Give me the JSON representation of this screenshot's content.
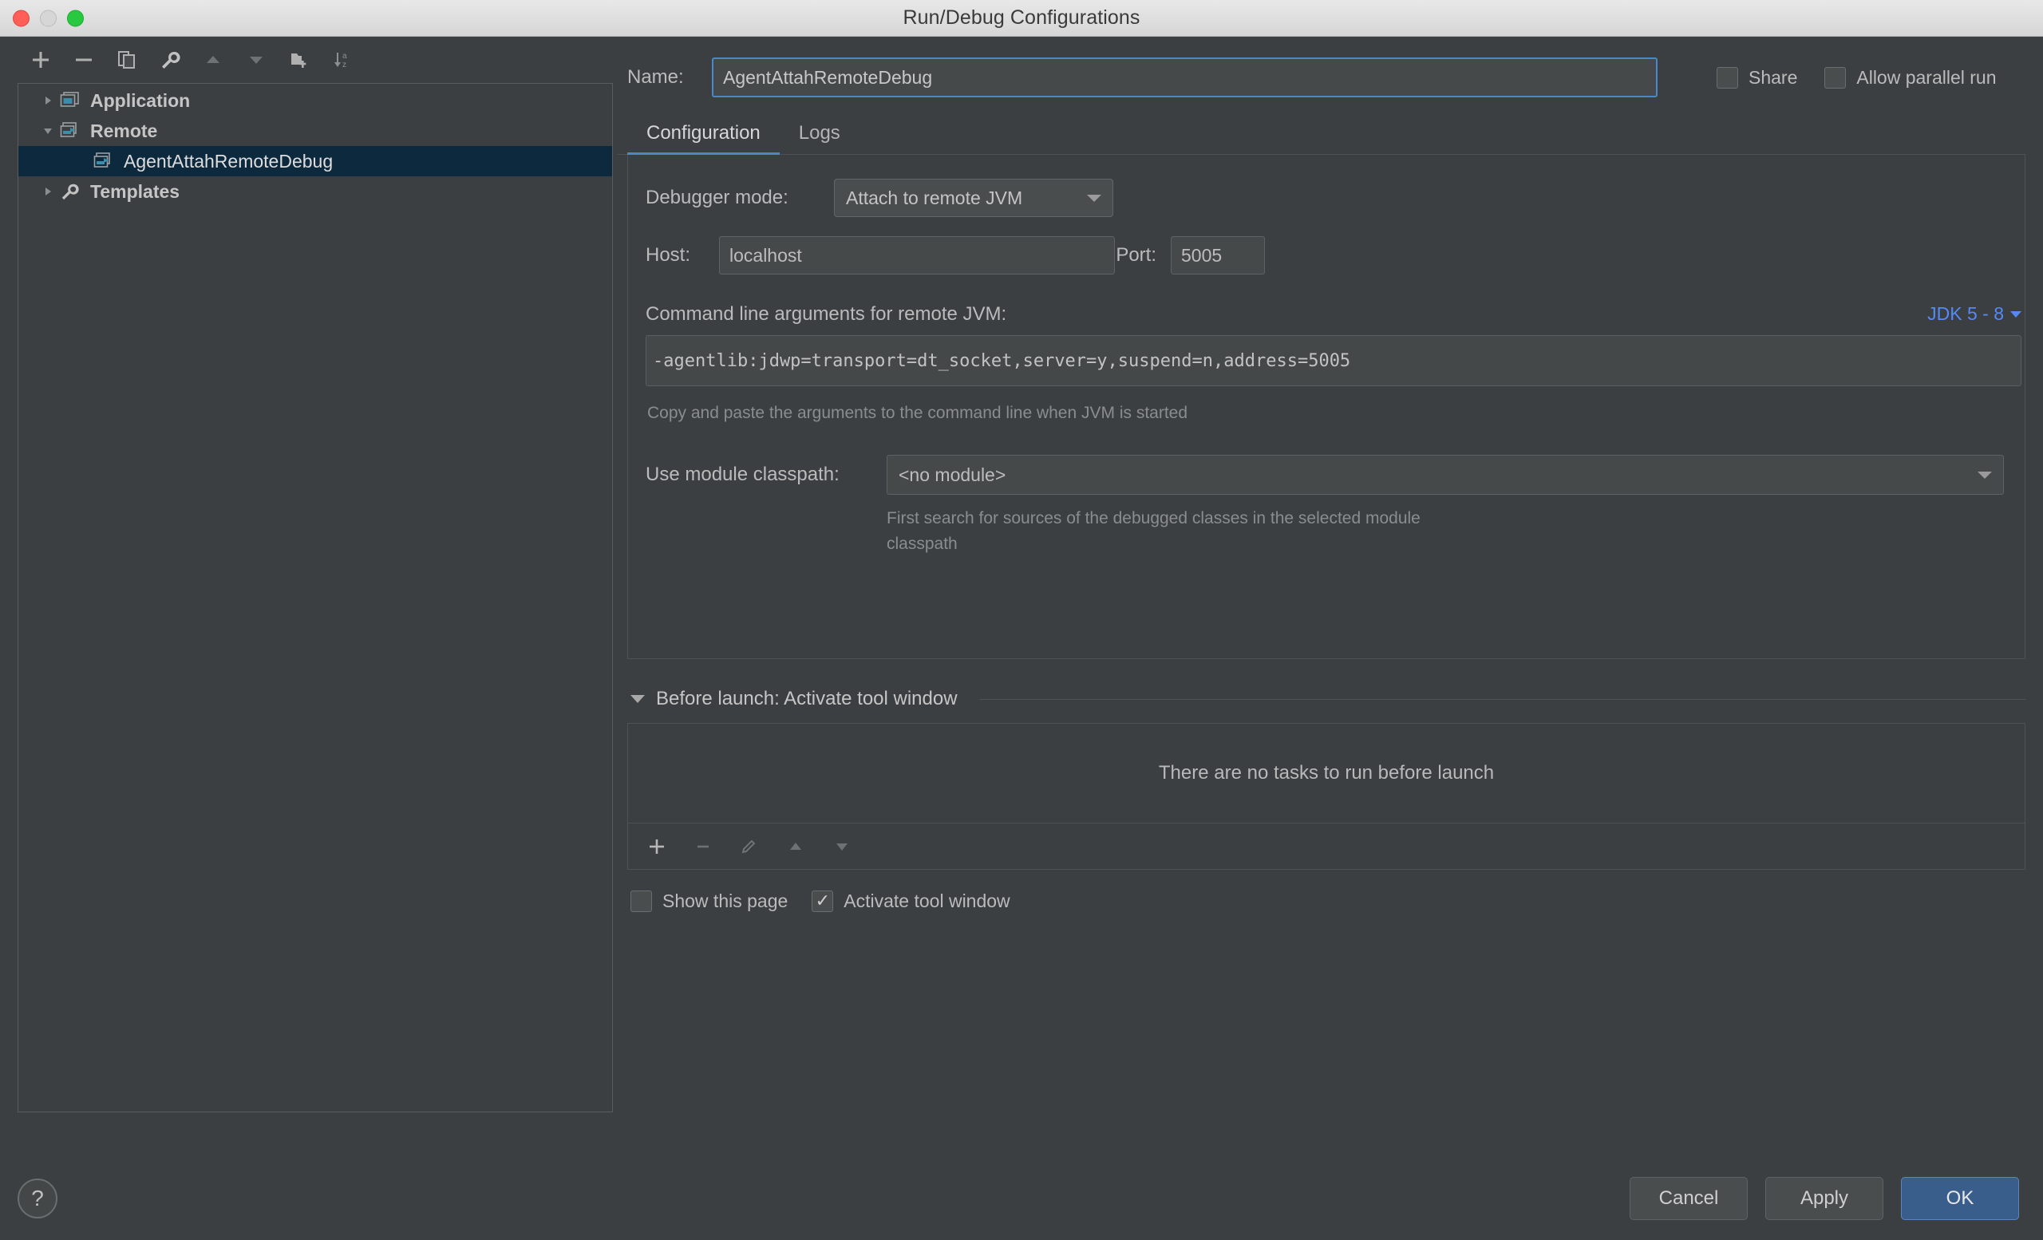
{
  "window": {
    "title": "Run/Debug Configurations",
    "traffic_lights": [
      "close",
      "minimize",
      "maximize"
    ]
  },
  "tree_toolbar": {
    "buttons": [
      {
        "name": "add",
        "icon": "plus-icon"
      },
      {
        "name": "remove",
        "icon": "minus-icon"
      },
      {
        "name": "copy",
        "icon": "copy-icon"
      },
      {
        "name": "edit-templates",
        "icon": "wrench-icon"
      },
      {
        "name": "move-up",
        "icon": "arrow-up-icon"
      },
      {
        "name": "move-down",
        "icon": "arrow-down-icon"
      },
      {
        "name": "move-into-folder",
        "icon": "folder-add-icon"
      },
      {
        "name": "sort-alphabetically",
        "icon": "sort-az-icon"
      }
    ]
  },
  "tree": {
    "items": [
      {
        "label": "Application",
        "expanded": false,
        "selected": false,
        "icon": "application-icon",
        "level": 0
      },
      {
        "label": "Remote",
        "expanded": true,
        "selected": false,
        "icon": "remote-icon",
        "level": 0
      },
      {
        "label": "AgentAttahRemoteDebug",
        "expanded": null,
        "selected": true,
        "icon": "remote-icon",
        "level": 1
      },
      {
        "label": "Templates",
        "expanded": false,
        "selected": false,
        "icon": "wrench-icon",
        "level": 0
      }
    ]
  },
  "name_row": {
    "label": "Name:",
    "value": "AgentAttahRemoteDebug",
    "placeholder": "",
    "share": {
      "label": "Share",
      "checked": false
    },
    "allow_parallel": {
      "label": "Allow parallel run",
      "checked": false
    }
  },
  "tabs": [
    {
      "label": "Configuration",
      "active": true
    },
    {
      "label": "Logs",
      "active": false
    }
  ],
  "configuration": {
    "debugger_mode": {
      "label": "Debugger mode:",
      "value": "Attach to remote JVM"
    },
    "host": {
      "label": "Host:",
      "value": "localhost"
    },
    "port": {
      "label": "Port:",
      "value": "5005"
    },
    "command_line": {
      "label": "Command line arguments for remote JVM:",
      "jdk_selector": "JDK 5 - 8",
      "value": "-agentlib:jdwp=transport=dt_socket,server=y,suspend=n,address=5005",
      "hint": "Copy and paste the arguments to the command line when JVM is started"
    },
    "module_classpath": {
      "label": "Use module classpath:",
      "value": "<no module>",
      "hint": "First search for sources of the debugged classes in the selected module classpath"
    }
  },
  "before_launch": {
    "title": "Before launch: Activate tool window",
    "empty_text": "There are no tasks to run before launch",
    "toolbar": [
      {
        "name": "add-task",
        "icon": "plus-icon"
      },
      {
        "name": "remove-task",
        "icon": "minus-icon"
      },
      {
        "name": "edit-task",
        "icon": "pencil-icon"
      },
      {
        "name": "task-move-up",
        "icon": "arrow-up-icon"
      },
      {
        "name": "task-move-down",
        "icon": "arrow-down-icon"
      }
    ],
    "show_this_page": {
      "label": "Show this page",
      "checked": false
    },
    "activate_tool_window": {
      "label": "Activate tool window",
      "checked": true
    }
  },
  "footer": {
    "help": "?",
    "cancel": "Cancel",
    "apply": "Apply",
    "ok": "OK"
  },
  "colors": {
    "background": "#3c3f41",
    "accent_blue": "#4a88c7",
    "link_blue": "#548af7",
    "selection": "#0d293e",
    "icon_teal": "#3b8eab"
  }
}
